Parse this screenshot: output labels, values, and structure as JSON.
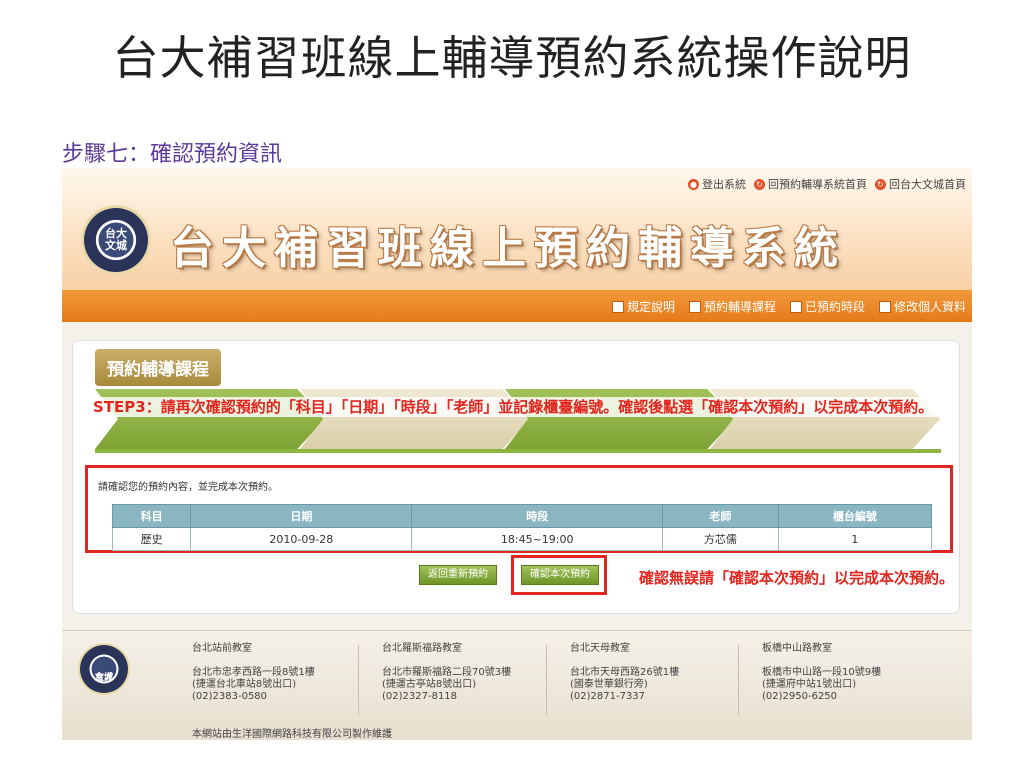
{
  "slide": {
    "title": "台大補習班線上輔導預約系統操作說明",
    "step_heading": "步驟七：確認預約資訊"
  },
  "site": {
    "top_links": [
      {
        "label": "登出系統",
        "icon": "logout-icon"
      },
      {
        "label": "回預約輔導系統首頁",
        "icon": "home-icon"
      },
      {
        "label": "回台大文城首頁",
        "icon": "home-icon"
      }
    ],
    "logo_text_1": "台大",
    "logo_text_2": "文城",
    "title": "台大補習班線上預約輔導系統",
    "nav": [
      {
        "label": "規定說明",
        "icon": "document-icon"
      },
      {
        "label": "預約輔導課程",
        "icon": "calendar-icon"
      },
      {
        "label": "已預約時段",
        "icon": "list-icon"
      },
      {
        "label": "修改個人資料",
        "icon": "user-edit-icon"
      }
    ]
  },
  "panel": {
    "tab": "預約輔導課程",
    "step_note": "STEP3：請再次確認預約的「科目」「日期」「時段」「老師」並記錄櫃臺編號。確認後點選「確認本次預約」以完成本次預約。",
    "confirm_text": "請確認您的預約內容，並完成本次預約。",
    "table": {
      "headers": [
        "科目",
        "日期",
        "時段",
        "老師",
        "櫃台編號"
      ],
      "rows": [
        [
          "歷史",
          "2010-09-28",
          "18:45~19:00",
          "方芯儒",
          "1"
        ]
      ]
    },
    "back_button": "返回重新預約",
    "confirm_button": "確認本次預約",
    "callout": "確認無誤請「確認本次預約」以完成本次預約。"
  },
  "footer": {
    "branches": [
      {
        "name": "台北站前教室",
        "address": "台北市忠孝西路一段8號1樓",
        "note": "(捷運台北車站8號出口)",
        "phone": "(02)2383-0580"
      },
      {
        "name": "台北羅斯福路教室",
        "address": "台北市羅斯福路二段70號3樓",
        "note": "(捷運古亭站8號出口)",
        "phone": "(02)2327-8118"
      },
      {
        "name": "台北天母教室",
        "address": "台北市天母西路26號1樓",
        "note": "(國泰世華銀行旁)",
        "phone": "(02)2871-7337"
      },
      {
        "name": "板橋中山路教室",
        "address": "板橋市中山路一段10號9樓",
        "note": "(捷運府中站1號出口)",
        "phone": "(02)2950-6250"
      }
    ],
    "credit": "本網站由生洋國際網路科技有限公司製作維護"
  },
  "colors": {
    "accent_orange": "#e5791c",
    "accent_green": "#7ea234",
    "alert_red": "#e0261f",
    "table_header": "#8ab6c2"
  }
}
